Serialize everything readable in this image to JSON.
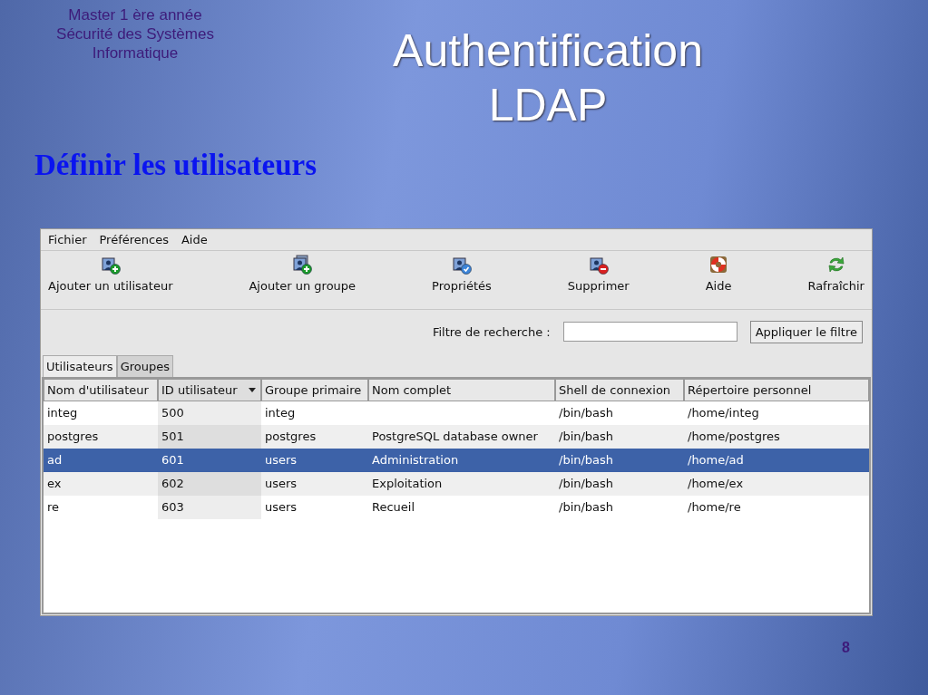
{
  "slide": {
    "subtitle_lines": [
      "Master 1 ère année",
      "Sécurité des Systèmes",
      "Informatique"
    ],
    "title": "Authentification LDAP",
    "heading": "Définir les utilisateurs",
    "page_number": "8"
  },
  "window": {
    "menu": [
      "Fichier",
      "Préférences",
      "Aide"
    ],
    "toolbar": [
      {
        "kind": "user-add",
        "label": "Ajouter un utilisateur"
      },
      {
        "kind": "group-add",
        "label": "Ajouter un groupe"
      },
      {
        "kind": "properties",
        "label": "Propriétés"
      },
      {
        "kind": "delete",
        "label": "Supprimer"
      },
      {
        "kind": "help",
        "label": "Aide"
      },
      {
        "kind": "refresh",
        "label": "Rafraîchir"
      }
    ],
    "filter": {
      "label": "Filtre de recherche :",
      "button": "Appliquer le filtre"
    },
    "tabs": [
      {
        "label": "Utilisateurs",
        "selected": true
      },
      {
        "label": "Groupes",
        "selected": false
      }
    ],
    "table": {
      "columns": [
        {
          "label": "Nom d'utilisateur",
          "sorted": false
        },
        {
          "label": "ID utilisateur",
          "sorted": true
        },
        {
          "label": "Groupe primaire",
          "sorted": false
        },
        {
          "label": "Nom complet",
          "sorted": false
        },
        {
          "label": "Shell de connexion",
          "sorted": false
        },
        {
          "label": "Répertoire personnel",
          "sorted": false
        }
      ],
      "rows": [
        {
          "selected": false,
          "cells": [
            "integ",
            "500",
            "integ",
            "",
            "/bin/bash",
            "/home/integ"
          ]
        },
        {
          "selected": false,
          "cells": [
            "postgres",
            "501",
            "postgres",
            "PostgreSQL database owner",
            "/bin/bash",
            "/home/postgres"
          ]
        },
        {
          "selected": true,
          "cells": [
            "ad",
            "601",
            "users",
            "Administration",
            "/bin/bash",
            "/home/ad"
          ]
        },
        {
          "selected": false,
          "cells": [
            "ex",
            "602",
            "users",
            "Exploitation",
            "/bin/bash",
            "/home/ex"
          ]
        },
        {
          "selected": false,
          "cells": [
            "re",
            "603",
            "users",
            "Recueil",
            "/bin/bash",
            "/home/re"
          ]
        }
      ]
    }
  }
}
